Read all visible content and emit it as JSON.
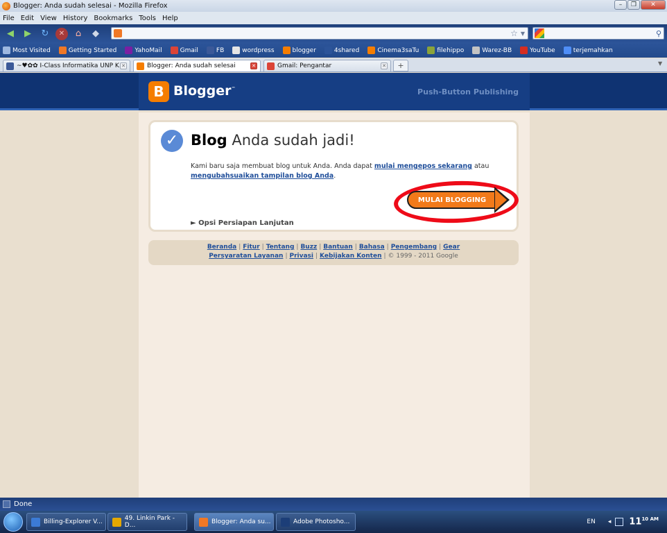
{
  "window": {
    "title": "Blogger: Anda sudah selesai - Mozilla Firefox"
  },
  "menu": [
    "File",
    "Edit",
    "View",
    "History",
    "Bookmarks",
    "Tools",
    "Help"
  ],
  "url": {
    "value": ""
  },
  "search": {
    "value": ""
  },
  "bookmarks": [
    {
      "label": "Most Visited",
      "color": "#9db7e0"
    },
    {
      "label": "Getting Started",
      "color": "#f07826"
    },
    {
      "label": "YahoMail",
      "color": "#7b1fa2"
    },
    {
      "label": "Gmail",
      "color": "#db4437"
    },
    {
      "label": "FB",
      "color": "#3b5998"
    },
    {
      "label": "wordpress",
      "color": "#e5e5e5"
    },
    {
      "label": "blogger",
      "color": "#f57d00"
    },
    {
      "label": "4shared",
      "color": "#2c5499"
    },
    {
      "label": "Cinema3saTu",
      "color": "#f57d00"
    },
    {
      "label": "filehippo",
      "color": "#8aa33a"
    },
    {
      "label": "Warez-BB",
      "color": "#c3c3c3"
    },
    {
      "label": "YouTube",
      "color": "#d62d20"
    },
    {
      "label": "terjemahkan",
      "color": "#4f8ef7"
    }
  ],
  "tabs": [
    {
      "label": "~♥✿✿ I-Class Informatika UNP K...",
      "color": "#3b5998"
    },
    {
      "label": "Blogger: Anda sudah selesai",
      "color": "#f57d00"
    },
    {
      "label": "Gmail: Pengantar",
      "color": "#db4437"
    }
  ],
  "newtab_label": "+",
  "header": {
    "logo_letter": "B",
    "brand": "Blogger",
    "tm": "™",
    "tagline": "Push-Button Publishing"
  },
  "card": {
    "heading_bold": "Blog",
    "heading_rest": " Anda sudah jadi!",
    "body_prefix": "Kami baru saja membuat blog untuk Anda. Anda dapat ",
    "link_post": "mulai mengepos sekarang",
    "body_mid": " atau ",
    "link_customize": "mengubahsuaikan tampilan blog Anda",
    "body_suffix": ".",
    "button": "MULAI BLOGGING",
    "advanced": "► Opsi Persiapan Lanjutan"
  },
  "footer": {
    "row1": [
      "Beranda",
      "Fitur",
      "Tentang",
      "Buzz",
      "Bantuan",
      "Bahasa",
      "Pengembang",
      "Gear"
    ],
    "row2": [
      "Persyaratan Layanan",
      "Privasi",
      "Kebijakan Konten"
    ],
    "copyright": "© 1999 - 2011 Google"
  },
  "status": {
    "text": "Done"
  },
  "taskbar": [
    {
      "label": "Billing-Explorer V...",
      "color": "#3c7bd6"
    },
    {
      "label": "49. Linkin Park - D...",
      "color": "#e5a800"
    },
    {
      "label": "Blogger: Anda su...",
      "color": "#f07826"
    },
    {
      "label": "Adobe Photosho...",
      "color": "#1c3e78"
    }
  ],
  "tray": {
    "lang": "EN",
    "clock": "11",
    "clock_sup": "10 AM"
  }
}
